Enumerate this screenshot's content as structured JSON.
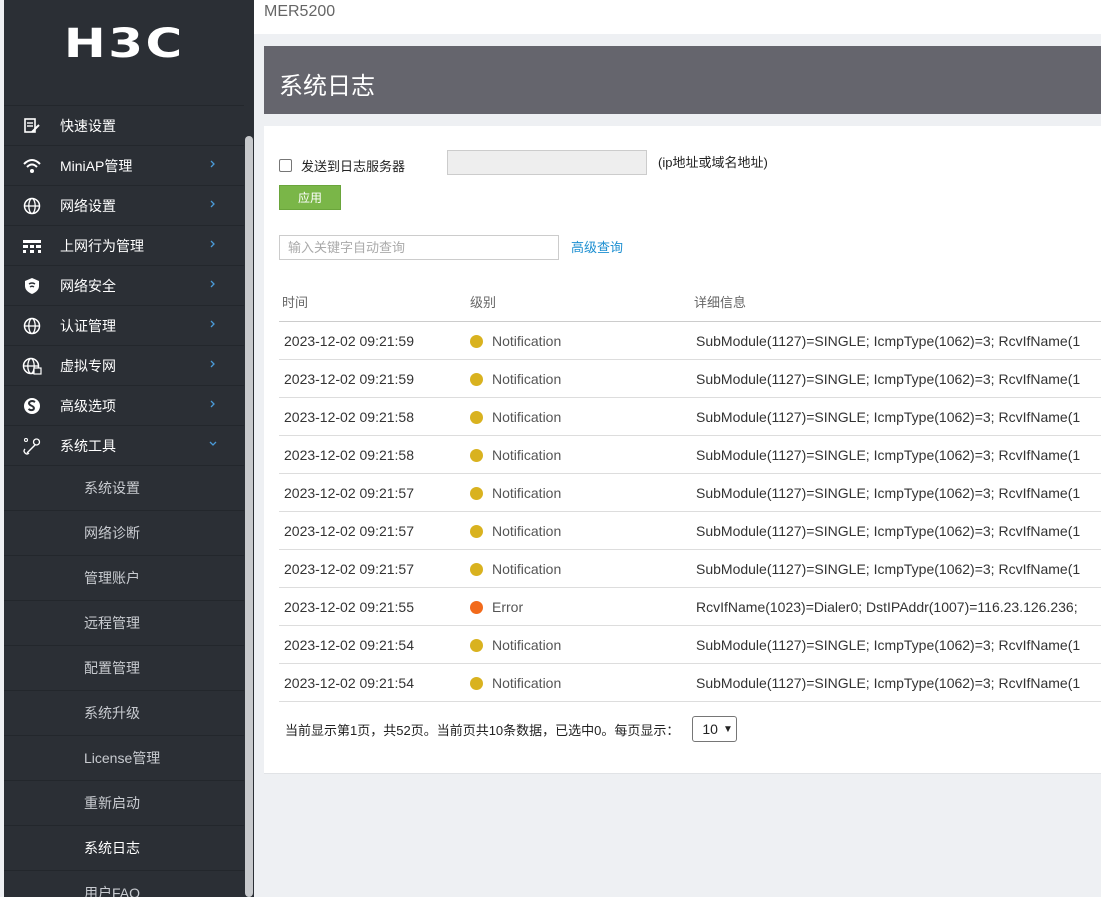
{
  "brand": {
    "logo": "H3C",
    "product": "MER5200"
  },
  "sidebar": {
    "menu": [
      {
        "label": "快速设置",
        "icon": "edit-doc-icon",
        "arrow": false
      },
      {
        "label": "MiniAP管理",
        "icon": "wifi-icon",
        "arrow": true
      },
      {
        "label": "网络设置",
        "icon": "globe-icon",
        "arrow": true
      },
      {
        "label": "上网行为管理",
        "icon": "grid-icon",
        "arrow": true
      },
      {
        "label": "网络安全",
        "icon": "shield-icon",
        "arrow": true
      },
      {
        "label": "认证管理",
        "icon": "globe-icon",
        "arrow": true
      },
      {
        "label": "虚拟专网",
        "icon": "vpn-globe-icon",
        "arrow": true
      },
      {
        "label": "高级选项",
        "icon": "advanced-icon",
        "arrow": true
      },
      {
        "label": "系统工具",
        "icon": "tools-icon",
        "arrow": "down"
      }
    ],
    "submenu": [
      "系统设置",
      "网络诊断",
      "管理账户",
      "远程管理",
      "配置管理",
      "系统升级",
      "License管理",
      "重新启动",
      "系统日志",
      "用户FAQ"
    ],
    "active_sub": "系统日志"
  },
  "page": {
    "title": "系统日志"
  },
  "log_server": {
    "checkbox_label": "发送到日志服务器",
    "input_value": "",
    "hint": "(ip地址或域名地址)",
    "apply_label": "应用"
  },
  "search": {
    "placeholder": "输入关键字自动查询",
    "advanced_label": "高级查询"
  },
  "table": {
    "headers": [
      "时间",
      "级别",
      "详细信息"
    ],
    "rows": [
      {
        "time": "2023-12-02 09:21:59",
        "level": "Notification",
        "detail": "SubModule(1127)=SINGLE; IcmpType(1062)=3; RcvIfName(1"
      },
      {
        "time": "2023-12-02 09:21:59",
        "level": "Notification",
        "detail": "SubModule(1127)=SINGLE; IcmpType(1062)=3; RcvIfName(1"
      },
      {
        "time": "2023-12-02 09:21:58",
        "level": "Notification",
        "detail": "SubModule(1127)=SINGLE; IcmpType(1062)=3; RcvIfName(1"
      },
      {
        "time": "2023-12-02 09:21:58",
        "level": "Notification",
        "detail": "SubModule(1127)=SINGLE; IcmpType(1062)=3; RcvIfName(1"
      },
      {
        "time": "2023-12-02 09:21:57",
        "level": "Notification",
        "detail": "SubModule(1127)=SINGLE; IcmpType(1062)=3; RcvIfName(1"
      },
      {
        "time": "2023-12-02 09:21:57",
        "level": "Notification",
        "detail": "SubModule(1127)=SINGLE; IcmpType(1062)=3; RcvIfName(1"
      },
      {
        "time": "2023-12-02 09:21:57",
        "level": "Notification",
        "detail": "SubModule(1127)=SINGLE; IcmpType(1062)=3; RcvIfName(1"
      },
      {
        "time": "2023-12-02 09:21:55",
        "level": "Error",
        "detail": "RcvIfName(1023)=Dialer0; DstIPAddr(1007)=116.23.126.236;"
      },
      {
        "time": "2023-12-02 09:21:54",
        "level": "Notification",
        "detail": "SubModule(1127)=SINGLE; IcmpType(1062)=3; RcvIfName(1"
      },
      {
        "time": "2023-12-02 09:21:54",
        "level": "Notification",
        "detail": "SubModule(1127)=SINGLE; IcmpType(1062)=3; RcvIfName(1"
      }
    ]
  },
  "pager": {
    "text": "当前显示第1页，共52页。当前页共10条数据，已选中0。每页显示：",
    "page_size": "10"
  },
  "colors": {
    "notification": "#d9b21f",
    "error": "#f26a1b",
    "apply": "#7ab648",
    "link": "#1d8fd1",
    "header_bar": "#65656d",
    "sidebar": "#2b2f35"
  }
}
